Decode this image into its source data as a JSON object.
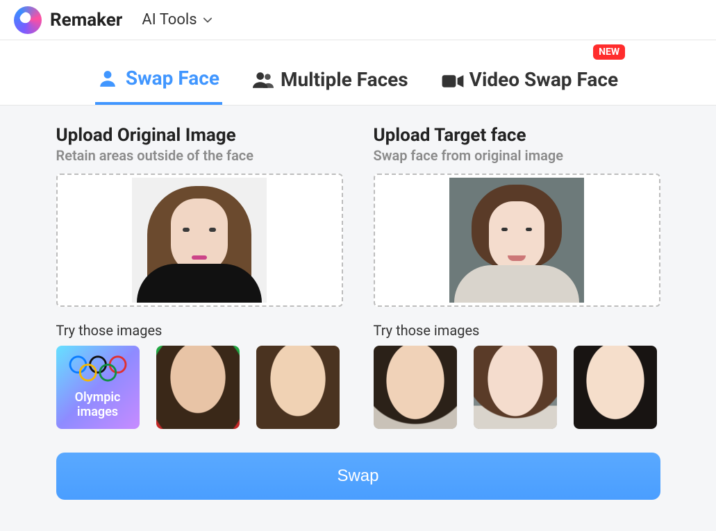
{
  "header": {
    "brand": "Remaker",
    "menu_label": "AI Tools"
  },
  "tabs": {
    "swap_face": "Swap Face",
    "multiple_faces": "Multiple Faces",
    "video_swap_face": "Video Swap Face",
    "badge": "NEW"
  },
  "original": {
    "title": "Upload Original Image",
    "subtitle": "Retain areas outside of the face",
    "try_label": "Try those images",
    "olympic_label": "Olympic\nimages"
  },
  "target": {
    "title": "Upload Target face",
    "subtitle": "Swap face from original image",
    "try_label": "Try those images"
  },
  "actions": {
    "swap": "Swap"
  }
}
